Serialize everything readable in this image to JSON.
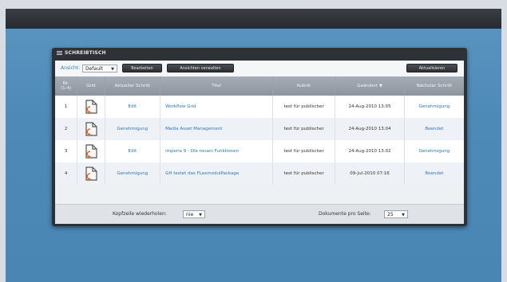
{
  "panel": {
    "title": "SCHREIBTISCH"
  },
  "toolbar": {
    "view_label": "Ansicht:",
    "view_value": "Default",
    "edit_button": "Bearbeiten",
    "manage_button": "Ansichten verwalten",
    "refresh_button": "Aktualisieren"
  },
  "table": {
    "headers": {
      "nr_line1": "Nr.",
      "nr_line2": "(1-4)",
      "grid": "Grid",
      "current_step": "Aktueller Schritt",
      "title": "Titel",
      "rubric": "Rubrik",
      "changed": "Geändert",
      "next_step": "Nächster Schritt"
    },
    "rows": [
      {
        "nr": "1",
        "current_step": "Edit",
        "title": "Workflow Grid",
        "rubric": "test für publischer",
        "changed": "24-Aug-2010 13:05",
        "next_step": "Genehmigung"
      },
      {
        "nr": "2",
        "current_step": "Genehmigung",
        "title": "Media Asset Management",
        "rubric": "test für publischer",
        "changed": "24-Aug-2010 13:04",
        "next_step": "Beendet"
      },
      {
        "nr": "3",
        "current_step": "Edit",
        "title": "imperia 9 - Die neuen Funktionen",
        "rubric": "test für publischer",
        "changed": "24-Aug-2010 13:02",
        "next_step": "Genehmigung"
      },
      {
        "nr": "4",
        "current_step": "Genehmigung",
        "title": "GH testet das FLexmodulPackage",
        "rubric": "test für publischer",
        "changed": "09-Jul-2010 07:16",
        "next_step": "Beendet"
      }
    ]
  },
  "footer": {
    "repeat_header_label": "Kopfzeile wiederholen:",
    "repeat_header_value": "nie",
    "per_page_label": "Dokumente pro Seite:",
    "per_page_value": "25"
  },
  "colors": {
    "accent": "#2b77bd",
    "panel": "#2e3136",
    "background": "#4e8ab8",
    "icon_accent": "#e8692a"
  }
}
